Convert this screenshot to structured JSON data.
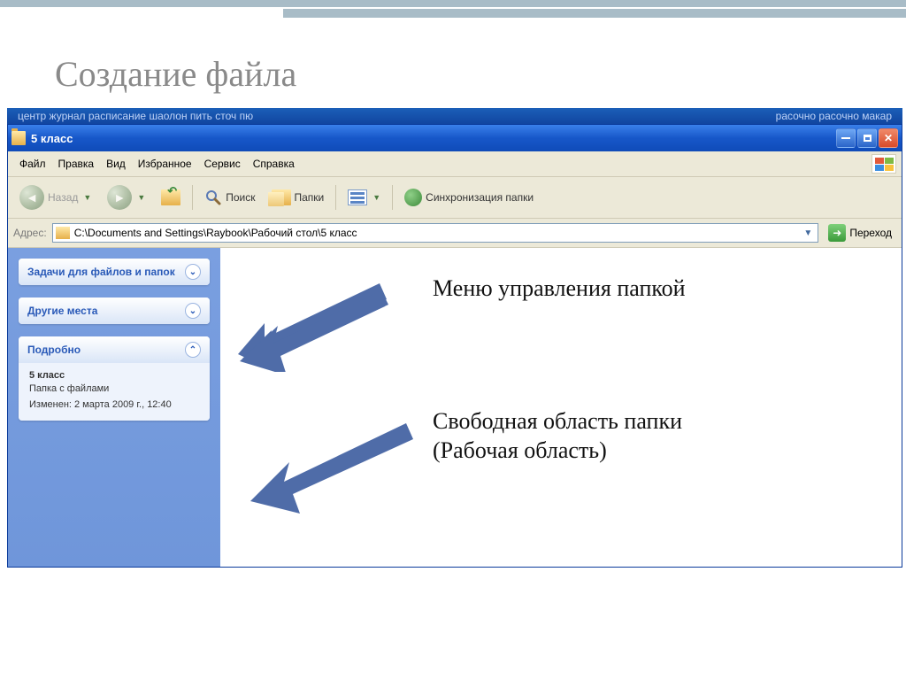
{
  "slide": {
    "title": "Создание файла"
  },
  "behind": {
    "left": "центр      журнал      расписание   шаолон  пить     сточ пю",
    "right": "расочно         расочно        макар"
  },
  "window": {
    "title": "5 класс"
  },
  "menu": {
    "file": "Файл",
    "edit": "Правка",
    "view": "Вид",
    "favorites": "Избранное",
    "tools": "Сервис",
    "help": "Справка"
  },
  "toolbar": {
    "back": "Назад",
    "search": "Поиск",
    "folders": "Папки",
    "sync": "Синхронизация папки"
  },
  "address": {
    "label": "Адрес:",
    "path": "C:\\Documents and Settings\\Raybook\\Рабочий стол\\5 класс",
    "go": "Переход"
  },
  "side": {
    "tasks": "Задачи для файлов и папок",
    "places": "Другие места",
    "details_title": "Подробно",
    "details": {
      "name": "5 класс",
      "type": "Папка с файлами",
      "modified": "Изменен: 2 марта 2009 г., 12:40"
    }
  },
  "annotations": {
    "menu_control": "Меню управления папкой",
    "free_area": "Свободная область папки (Рабочая область)"
  }
}
